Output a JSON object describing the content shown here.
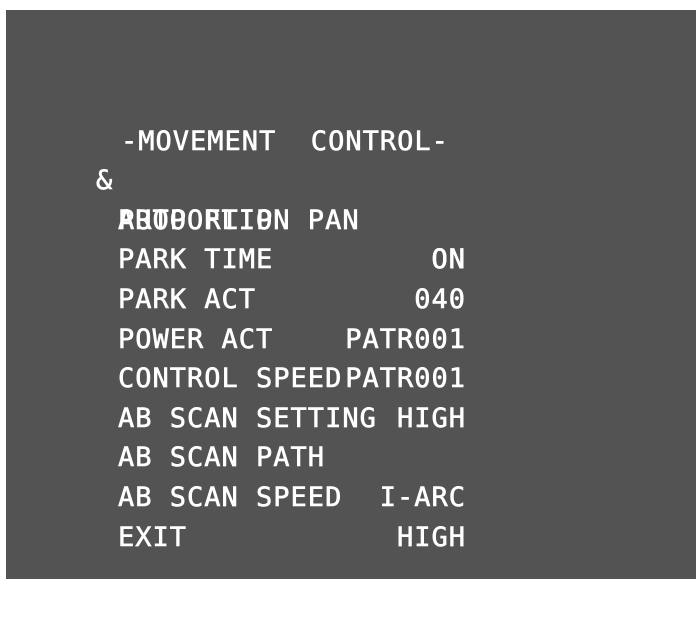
{
  "menu": {
    "title": "-MOVEMENT  CONTROL-",
    "cursor": "&",
    "items": [
      {
        "label": "AUTO FLIP",
        "value": "ON"
      },
      {
        "label": "PROPORTION PAN",
        "value": "ON"
      },
      {
        "label": "PARK TIME",
        "value": "040"
      },
      {
        "label": "PARK ACT",
        "value": "PATR001"
      },
      {
        "label": "POWER ACT",
        "value": "PATR001"
      },
      {
        "label": "CONTROL SPEED",
        "value": "HIGH"
      },
      {
        "label": "AB SCAN SETTING",
        "value": ""
      },
      {
        "label": "AB SCAN PATH",
        "value": "I-ARC"
      },
      {
        "label": "AB SCAN SPEED",
        "value": "HIGH"
      },
      {
        "label": "EXIT",
        "value": ""
      }
    ]
  },
  "colors": {
    "background": "#535353",
    "text": "#ffffff",
    "frame": "#ffffff"
  }
}
